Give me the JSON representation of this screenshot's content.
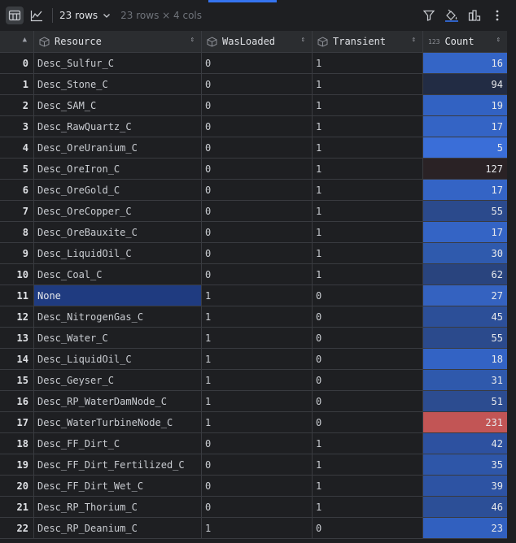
{
  "toolbar": {
    "rows_label": "23 rows",
    "meta_label": "23 rows × 4 cols",
    "icons": [
      "table-view-icon",
      "chart-view-icon",
      "chevron-down-icon",
      "filter-icon",
      "paint-bucket-icon",
      "chart-options-icon",
      "more-vertical-icon"
    ]
  },
  "columns": [
    {
      "label": "",
      "icon": "sort-icon"
    },
    {
      "label": "Resource",
      "icon": "cube-icon"
    },
    {
      "label": "WasLoaded",
      "icon": "cube-icon"
    },
    {
      "label": "Transient",
      "icon": "cube-icon"
    },
    {
      "label": "Count",
      "icon": "numeric-type-icon",
      "type_glyph": "123"
    }
  ],
  "rows": [
    {
      "idx": "0",
      "resource": "Desc_Sulfur_C",
      "was_loaded": "0",
      "transient": "1",
      "count": "16",
      "color": "#3465c6"
    },
    {
      "idx": "1",
      "resource": "Desc_Stone_C",
      "was_loaded": "0",
      "transient": "1",
      "count": "94",
      "color": "#222c44"
    },
    {
      "idx": "2",
      "resource": "Desc_SAM_C",
      "was_loaded": "0",
      "transient": "1",
      "count": "19",
      "color": "#3262c2"
    },
    {
      "idx": "3",
      "resource": "Desc_RawQuartz_C",
      "was_loaded": "0",
      "transient": "1",
      "count": "17",
      "color": "#3464c5"
    },
    {
      "idx": "4",
      "resource": "Desc_OreUranium_C",
      "was_loaded": "0",
      "transient": "1",
      "count": "5",
      "color": "#3a6ed8"
    },
    {
      "idx": "5",
      "resource": "Desc_OreIron_C",
      "was_loaded": "0",
      "transient": "1",
      "count": "127",
      "color": "#2a2225"
    },
    {
      "idx": "6",
      "resource": "Desc_OreGold_C",
      "was_loaded": "0",
      "transient": "1",
      "count": "17",
      "color": "#3464c5"
    },
    {
      "idx": "7",
      "resource": "Desc_OreCopper_C",
      "was_loaded": "0",
      "transient": "1",
      "count": "55",
      "color": "#2b4a8c"
    },
    {
      "idx": "8",
      "resource": "Desc_OreBauxite_C",
      "was_loaded": "0",
      "transient": "1",
      "count": "17",
      "color": "#3464c5"
    },
    {
      "idx": "9",
      "resource": "Desc_LiquidOil_C",
      "was_loaded": "0",
      "transient": "1",
      "count": "30",
      "color": "#2f5aad"
    },
    {
      "idx": "10",
      "resource": "Desc_Coal_C",
      "was_loaded": "0",
      "transient": "1",
      "count": "62",
      "color": "#29447e"
    },
    {
      "idx": "11",
      "resource": "None",
      "was_loaded": "1",
      "transient": "0",
      "count": "27",
      "color": "#3462c0",
      "selected": true
    },
    {
      "idx": "12",
      "resource": "Desc_NitrogenGas_C",
      "was_loaded": "1",
      "transient": "0",
      "count": "45",
      "color": "#2c4f98"
    },
    {
      "idx": "13",
      "resource": "Desc_Water_C",
      "was_loaded": "1",
      "transient": "0",
      "count": "55",
      "color": "#2b4a8c"
    },
    {
      "idx": "14",
      "resource": "Desc_LiquidOil_C",
      "was_loaded": "1",
      "transient": "0",
      "count": "18",
      "color": "#3363c4"
    },
    {
      "idx": "15",
      "resource": "Desc_Geyser_C",
      "was_loaded": "1",
      "transient": "0",
      "count": "31",
      "color": "#2f59ac"
    },
    {
      "idx": "16",
      "resource": "Desc_RP_WaterDamNode_C",
      "was_loaded": "1",
      "transient": "0",
      "count": "51",
      "color": "#2c4c90"
    },
    {
      "idx": "17",
      "resource": "Desc_WaterTurbineNode_C",
      "was_loaded": "1",
      "transient": "0",
      "count": "231",
      "color": "#c25555"
    },
    {
      "idx": "18",
      "resource": "Desc_FF_Dirt_C",
      "was_loaded": "0",
      "transient": "1",
      "count": "42",
      "color": "#2d51a0"
    },
    {
      "idx": "19",
      "resource": "Desc_FF_Dirt_Fertilized_C",
      "was_loaded": "0",
      "transient": "1",
      "count": "35",
      "color": "#2e56a8"
    },
    {
      "idx": "20",
      "resource": "Desc_FF_Dirt_Wet_C",
      "was_loaded": "0",
      "transient": "1",
      "count": "39",
      "color": "#2d53a3"
    },
    {
      "idx": "21",
      "resource": "Desc_RP_Thorium_C",
      "was_loaded": "0",
      "transient": "1",
      "count": "46",
      "color": "#2c4f97"
    },
    {
      "idx": "22",
      "resource": "Desc_RP_Deanium_C",
      "was_loaded": "1",
      "transient": "0",
      "count": "23",
      "color": "#3160bf"
    }
  ]
}
